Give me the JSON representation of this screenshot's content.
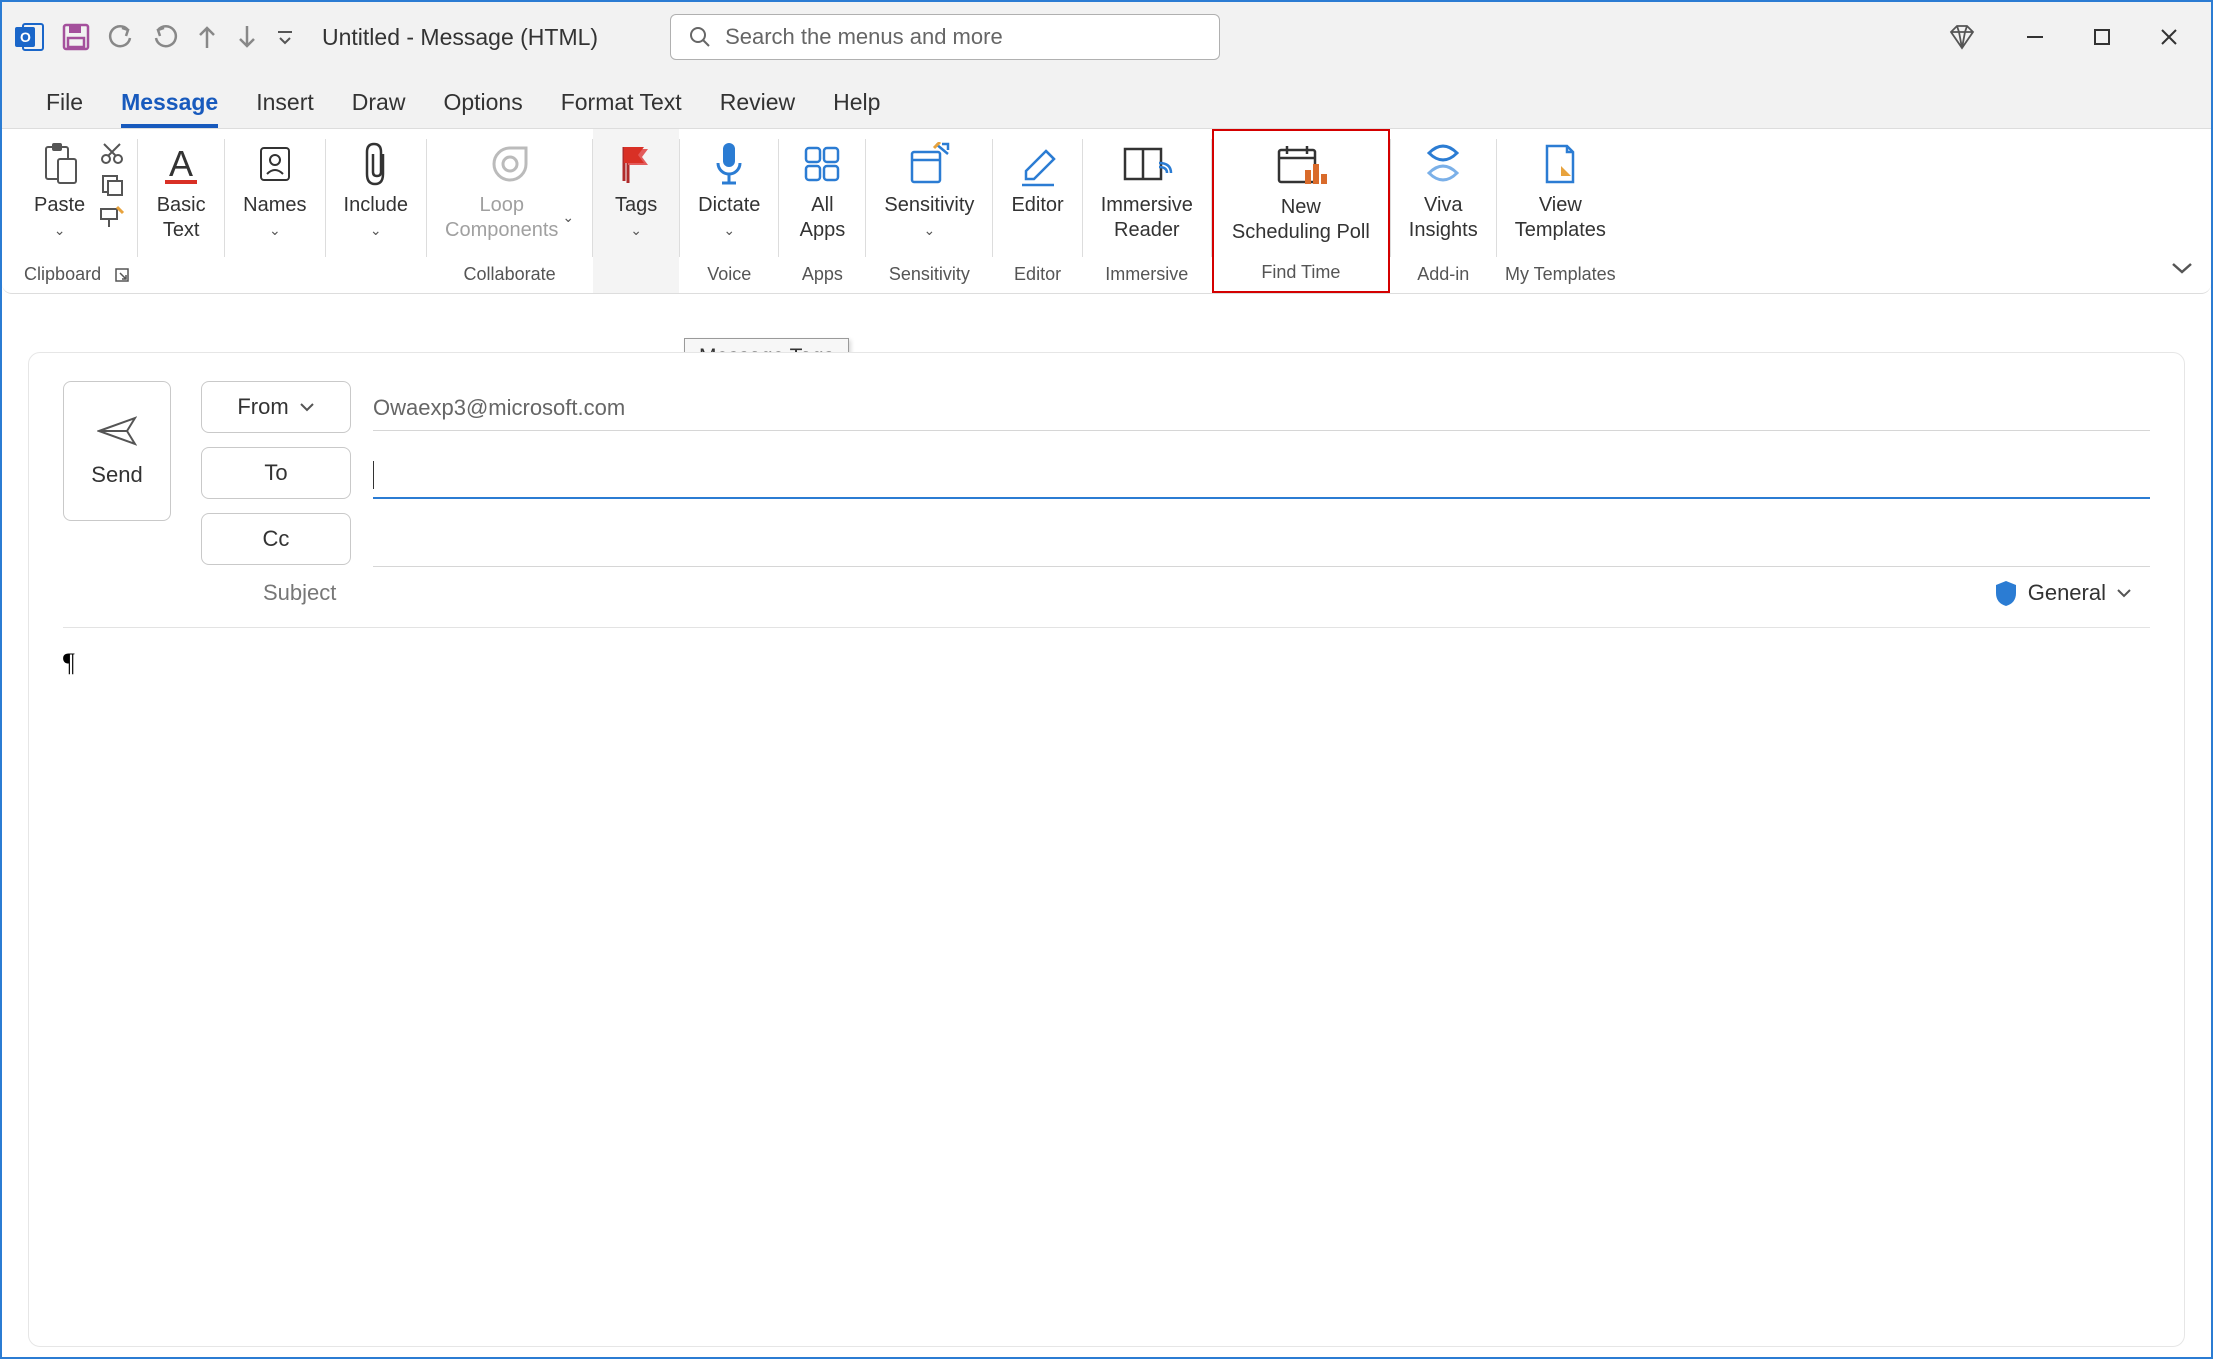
{
  "titlebar": {
    "title": "Untitled  -  Message (HTML)",
    "search_placeholder": "Search the menus and more"
  },
  "tabs": {
    "file": "File",
    "message": "Message",
    "insert": "Insert",
    "draw": "Draw",
    "options": "Options",
    "format_text": "Format Text",
    "review": "Review",
    "help": "Help"
  },
  "ribbon": {
    "clipboard": {
      "paste": "Paste",
      "label": "Clipboard"
    },
    "basic_text": "Basic\nText",
    "names": "Names",
    "include": "Include",
    "loop": "Loop\nComponents",
    "collaborate": "Collaborate",
    "tags": "Tags",
    "dictate": "Dictate",
    "voice": "Voice",
    "all_apps": "All\nApps",
    "apps": "Apps",
    "sensitivity": "Sensitivity",
    "sensitivity_label": "Sensitivity",
    "editor": "Editor",
    "editor_label": "Editor",
    "immersive_reader": "Immersive\nReader",
    "immersive": "Immersive",
    "new_poll": "New\nScheduling Poll",
    "find_time": "Find Time",
    "viva": "Viva\nInsights",
    "addin": "Add-in",
    "view_templates": "View\nTemplates",
    "my_templates": "My Templates",
    "tooltip": "Message Tags"
  },
  "compose": {
    "send": "Send",
    "from": "From",
    "to": "To",
    "cc": "Cc",
    "from_addr": "Owaexp3@microsoft.com",
    "subject": "Subject",
    "sensitivity": "General",
    "body": "¶"
  }
}
